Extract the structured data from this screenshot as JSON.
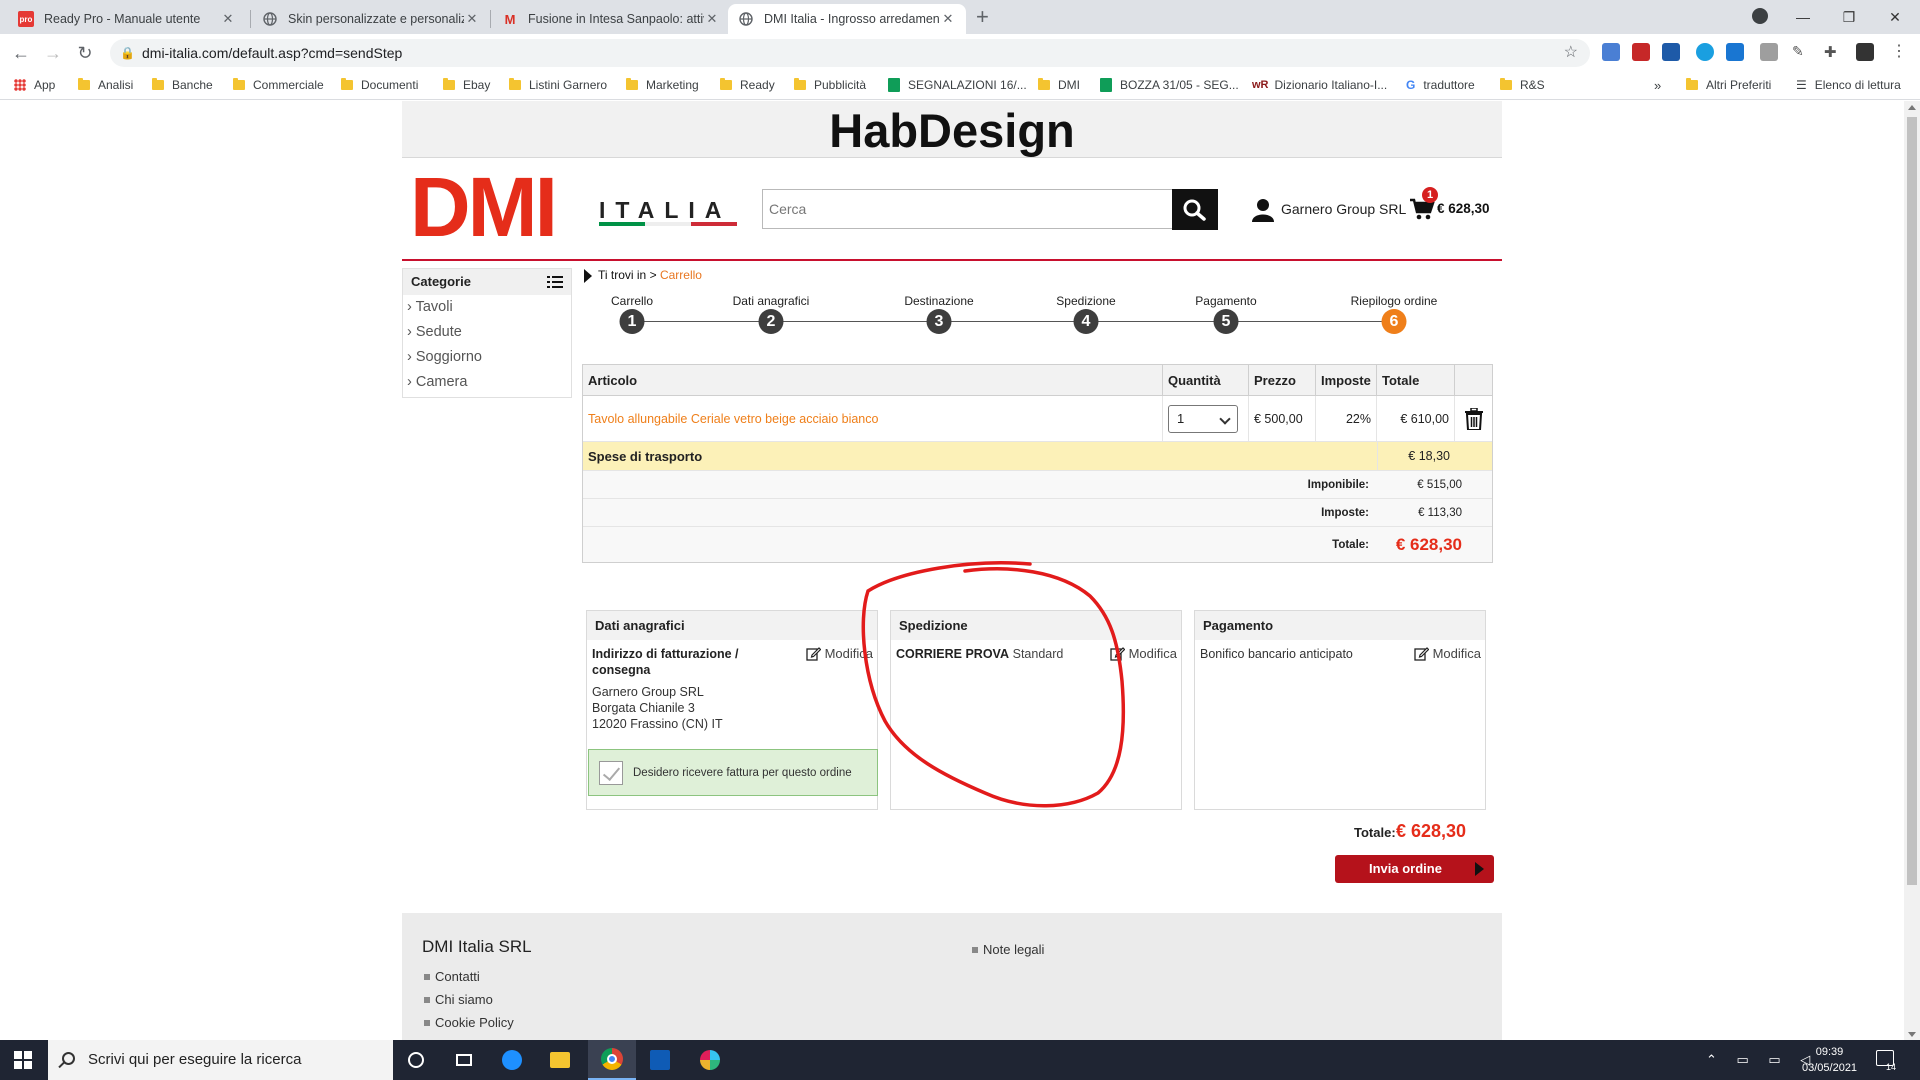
{
  "browser": {
    "tabs": [
      {
        "title": "Ready Pro - Manuale utente",
        "icon": "ready-pro-favicon"
      },
      {
        "title": "Skin personalizzate e personalizz",
        "icon": "globe-icon"
      },
      {
        "title": "Fusione in Intesa Sanpaolo: attiva",
        "icon": "gmail-icon"
      },
      {
        "title": "DMI Italia - Ingrosso arredament",
        "icon": "globe-icon"
      }
    ],
    "new_tab": "+",
    "url": "dmi-italia.com/default.asp?cmd=sendStep",
    "bookmarks": [
      "App",
      "Analisi",
      "Banche",
      "Commerciale",
      "Documenti",
      "Ebay",
      "Listini Garnero",
      "Marketing",
      "Ready",
      "Pubblicità",
      "SEGNALAZIONI 16/...",
      "DMI",
      "BOZZA 31/05 - SEG...",
      "Dizionario Italiano-I...",
      "traduttore",
      "R&S"
    ],
    "bookmarks_more": "»",
    "other_bookmarks": "Altri Preferiti",
    "reading_list": "Elenco di lettura"
  },
  "site": {
    "banner_title": "HabDesign",
    "logo_main": "DMI",
    "logo_sub": "ITALIA",
    "search_placeholder": "Cerca",
    "user_name": "Garnero Group SRL",
    "cart_count": "1",
    "cart_total": "€ 628,30",
    "colors": {
      "brand_red": "#e52d1a",
      "accent_orange": "#ef7f1a",
      "flag_green": "#009246",
      "flag_white": "#ffffff",
      "flag_red": "#ce2b37"
    }
  },
  "sidebar": {
    "title": "Categorie",
    "items": [
      "Tavoli",
      "Sedute",
      "Soggiorno",
      "Camera"
    ]
  },
  "breadcrumb": {
    "prefix": "Ti trovi in",
    "separator": ">",
    "current": "Carrello"
  },
  "steps": [
    {
      "label": "Carrello",
      "num": "1"
    },
    {
      "label": "Dati anagrafici",
      "num": "2"
    },
    {
      "label": "Destinazione",
      "num": "3"
    },
    {
      "label": "Spedizione",
      "num": "4"
    },
    {
      "label": "Pagamento",
      "num": "5"
    },
    {
      "label": "Riepilogo ordine",
      "num": "6",
      "active": true
    }
  ],
  "cart": {
    "headers": {
      "article": "Articolo",
      "qty": "Quantità",
      "price": "Prezzo",
      "tax": "Imposte",
      "total": "Totale"
    },
    "item": {
      "name": "Tavolo allungabile Ceriale vetro beige acciaio bianco",
      "qty": "1",
      "price": "€ 500,00",
      "tax": "22%",
      "total": "€ 610,00"
    },
    "shipping": {
      "label": "Spese di trasporto",
      "value": "€ 18,30"
    },
    "taxable": {
      "label": "Imponibile:",
      "value": "€ 515,00"
    },
    "taxes": {
      "label": "Imposte:",
      "value": "€ 113,30"
    },
    "grand": {
      "label": "Totale:",
      "value": "€ 628,30"
    }
  },
  "summary": {
    "personal": {
      "title": "Dati anagrafici",
      "edit": "Modifica",
      "address_title": "Indirizzo di fatturazione / consegna",
      "lines": [
        "Garnero Group SRL",
        "Borgata Chianile 3",
        "12020 Frassino (CN) IT"
      ],
      "invoice_label": "Desidero ricevere fattura per questo ordine"
    },
    "shipping": {
      "title": "Spedizione",
      "carrier": "CORRIERE PROVA",
      "service": "Standard",
      "edit": "Modifica"
    },
    "payment": {
      "title": "Pagamento",
      "method": "Bonifico bancario anticipato",
      "edit": "Modifica"
    }
  },
  "order": {
    "total_label": "Totale:",
    "total_value": "€ 628,30",
    "send_label": "Invia ordine"
  },
  "footer": {
    "company": "DMI Italia SRL",
    "links": [
      "Contatti",
      "Chi siamo",
      "Cookie Policy"
    ],
    "legal": "Note legali"
  },
  "taskbar": {
    "search_placeholder": "Scrivi qui per eseguire la ricerca",
    "time": "09:39",
    "date": "03/05/2021",
    "notifications": "14"
  }
}
